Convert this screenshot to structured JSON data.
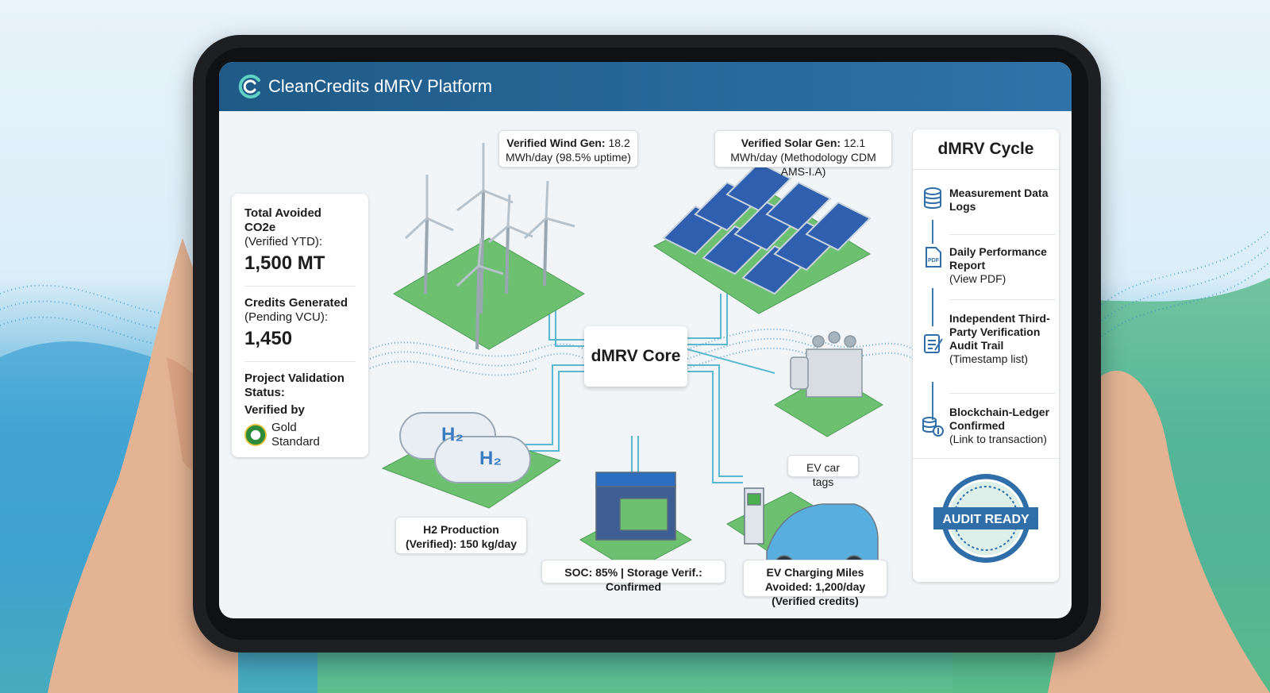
{
  "app": {
    "title": "CleanCredits dMRV Platform"
  },
  "core": {
    "label": "dMRV Core"
  },
  "callouts": {
    "wind_bold": "Verified Wind Gen:",
    "wind_rest": " 18.2 MWh/day (98.5% uptime)",
    "solar_bold": "Verified Solar Gen:",
    "solar_rest": " 12.1 MWh/day (Methodology CDM AMS-I.A)",
    "h2": "H2 Production (Verified): 150 kg/day",
    "soc": "SOC: 85% | Storage Verif.: Confirmed",
    "ev": "EV Charging Miles Avoided: 1,200/day (Verified credits)",
    "ev_tags": "EV car tags"
  },
  "left_panel": {
    "avoided_label": "Total Avoided CO2e",
    "avoided_sub": "(Verified YTD):",
    "avoided_value": "1,500 MT",
    "credits_label": "Credits Generated",
    "credits_sub": "(Pending VCU):",
    "credits_value": "1,450",
    "status_label": "Project Validation Status:",
    "status_value": "Verified by",
    "gs_text": "Gold Standard"
  },
  "right_panel": {
    "title": "dMRV Cycle",
    "steps": [
      {
        "bold": "Measurement Data Logs",
        "sub": ""
      },
      {
        "bold": "Daily Performance Report",
        "sub": "(View PDF)"
      },
      {
        "bold": "Independent Third-Party Verification Audit Trail",
        "sub": "(Timestamp list)"
      },
      {
        "bold": "Blockchain-Ledger Confirmed",
        "sub": "(Link to transaction)"
      }
    ],
    "pdf_label": "PDF",
    "audit_badge": "AUDIT READY"
  },
  "icons": [
    "database-icon",
    "pdf-icon",
    "clipboard-check-icon",
    "coins-icon"
  ],
  "colors": {
    "header": "#2b6a9e",
    "accent": "#3a7bb0",
    "green": "#6cc070"
  }
}
